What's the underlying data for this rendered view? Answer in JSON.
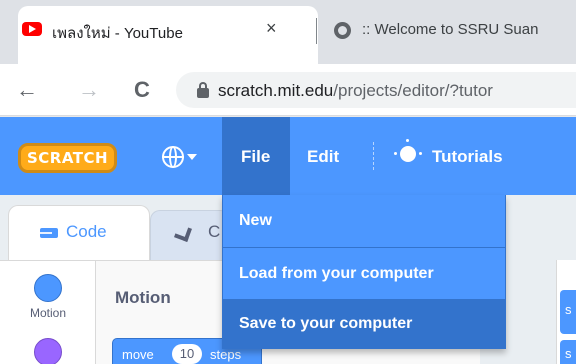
{
  "browser": {
    "tabs": [
      {
        "title": "เพลงใหม่ - YouTube",
        "active": true,
        "close": "×"
      },
      {
        "title": ":: Welcome to SSRU Suan",
        "active": false
      }
    ],
    "nav": {
      "back": "←",
      "forward": "→",
      "reload": "C"
    },
    "url": {
      "host": "scratch.mit.edu",
      "path": "/projects/editor/?tutor"
    }
  },
  "menubar": {
    "logo": "SCRATCH",
    "file": "File",
    "edit": "Edit",
    "tutorials": "Tutorials"
  },
  "file_menu": {
    "items": [
      {
        "label": "New"
      },
      {
        "label": "Load from your computer"
      },
      {
        "label": "Save to your computer",
        "highlighted": true
      }
    ]
  },
  "editor": {
    "tabs": {
      "code": "Code",
      "costumes": "C"
    },
    "categories": [
      {
        "label": "Motion",
        "color": "#4c97ff"
      },
      {
        "label": "",
        "color": "#9966ff"
      }
    ],
    "palette_heading": "Motion",
    "block": {
      "word": "move",
      "value": "10",
      "unit": "steps"
    },
    "stage_edge_letters": [
      "s",
      "s"
    ]
  },
  "colors": {
    "accent": "#4c97ff",
    "accent_dark": "#3373cc",
    "logo": "#ffab19"
  }
}
